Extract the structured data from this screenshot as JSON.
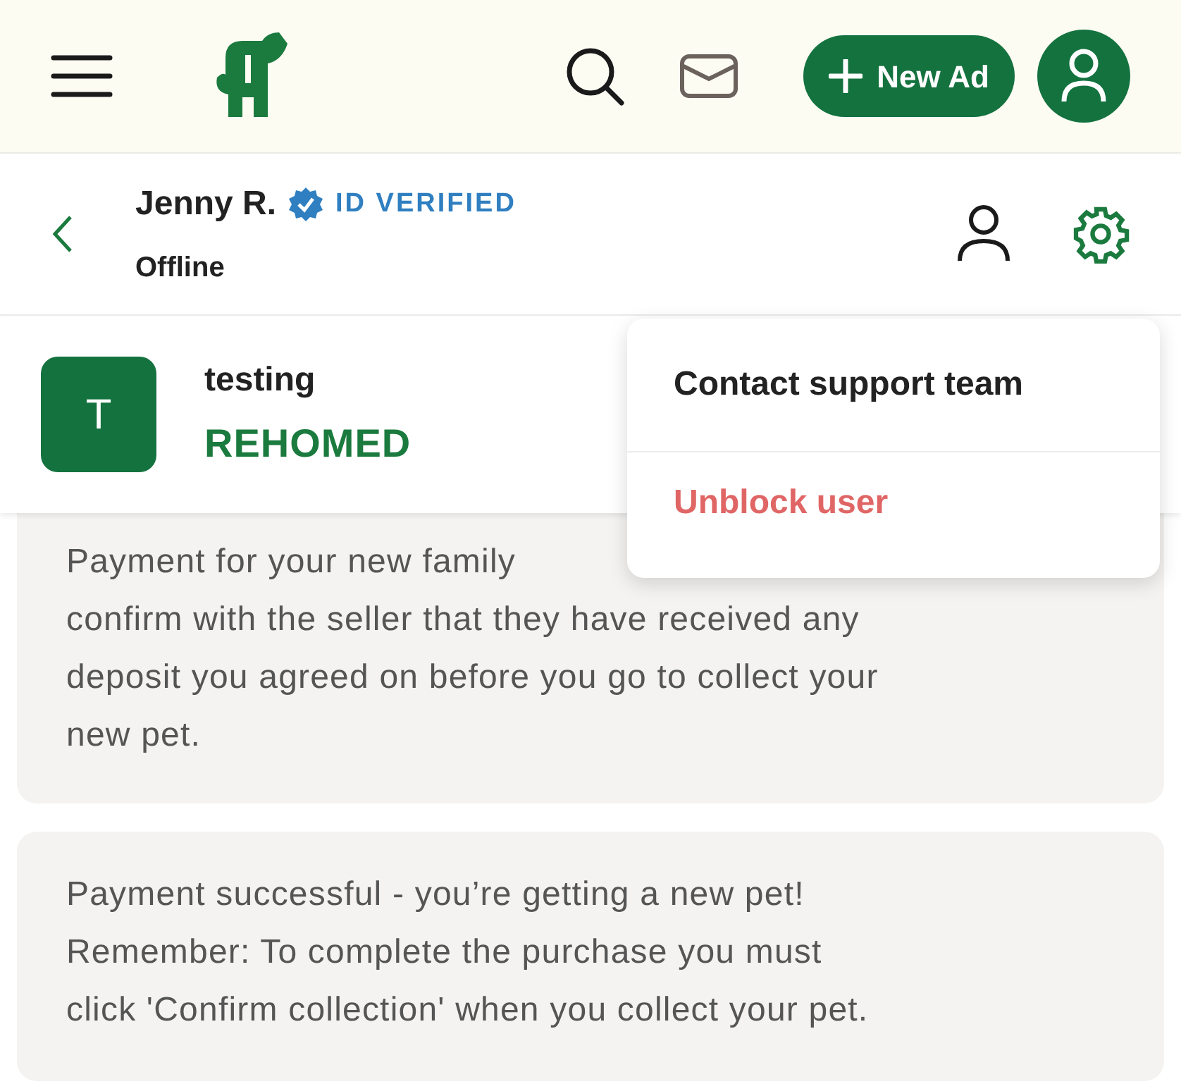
{
  "top_bar": {
    "new_ad_button": "New Ad"
  },
  "chat_header": {
    "name": "Jenny R.",
    "badge": "ID VERIFIED",
    "status": "Offline"
  },
  "listing": {
    "avatar_letter": "T",
    "title": "testing",
    "status": "REHOMED"
  },
  "menu": [
    {
      "label": "Contact support team",
      "kind": "normal"
    },
    {
      "label": "Unblock user",
      "kind": "danger"
    }
  ],
  "messages": [
    {
      "lines": [
        "Payment for your new family",
        "confirm with the seller that they have received any",
        "deposit you agreed on before you go to collect your",
        "new pet."
      ]
    },
    {
      "lines": [
        "Payment successful - you’re getting a new pet!",
        "Remember: To complete the purchase you must",
        "click 'Confirm collection' when you collect your pet."
      ]
    }
  ]
}
